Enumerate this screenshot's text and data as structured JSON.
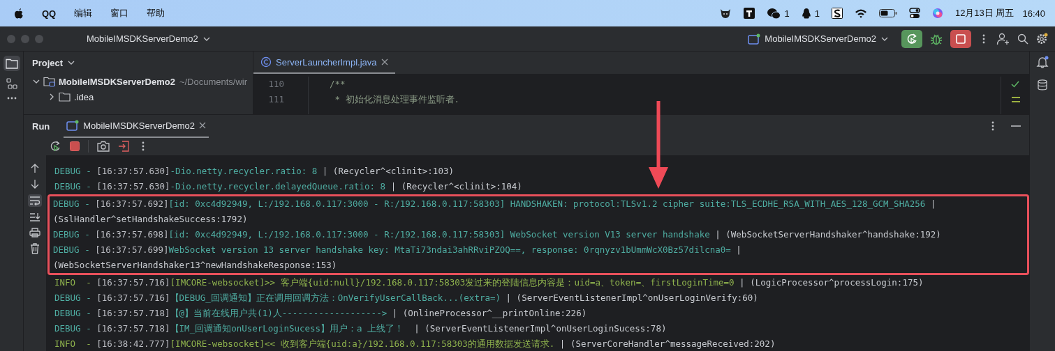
{
  "menubar": {
    "menus": [
      "QQ",
      "编辑",
      "窗口",
      "帮助"
    ],
    "wechat_count": "1",
    "qq_count": "1",
    "date": "12月13日 周五",
    "time": "16:40"
  },
  "titlebar": {
    "project": "MobileIMSDKServerDemo2",
    "run_config": "MobileIMSDKServerDemo2"
  },
  "project_panel": {
    "title": "Project",
    "tree": [
      {
        "name": "MobileIMSDKServerDemo2",
        "path": "~/Documents/wir",
        "expanded": true,
        "children": [
          {
            "name": ".idea",
            "expanded": false
          }
        ]
      }
    ]
  },
  "editor": {
    "tab": "ServerLauncherImpl.java",
    "lines": [
      {
        "number": "110",
        "code": "/**"
      },
      {
        "number": "111",
        "code": " * 初始化消息处理事件监听者."
      }
    ]
  },
  "run_panel": {
    "title": "Run",
    "tab": "MobileIMSDKServerDemo2",
    "log": [
      {
        "level": "DEBUG -",
        "time": "[16:37:57.630]",
        "message": "-Dio.netty.recycler.ratio: 8",
        "source": " | (Recycler^<clinit>:103)",
        "highlighted": false
      },
      {
        "level": "DEBUG -",
        "time": "[16:37:57.630]",
        "message": "-Dio.netty.recycler.delayedQueue.ratio: 8",
        "source": " | (Recycler^<clinit>:104)",
        "highlighted": false
      },
      {
        "level": "DEBUG -",
        "time": "[16:37:57.692]",
        "message": "[id: 0xc4d92949, L:/192.168.0.117:3000 - R:/192.168.0.117:58303] HANDSHAKEN: protocol:TLSv1.2 cipher suite:TLS_ECDHE_RSA_WITH_AES_128_GCM_SHA256",
        "source": " | (SslHandler^setHandshakeSuccess:1792)",
        "highlighted": true
      },
      {
        "level": "DEBUG -",
        "time": "[16:37:57.698]",
        "message": "[id: 0xc4d92949, L:/192.168.0.117:3000 - R:/192.168.0.117:58303] WebSocket version V13 server handshake",
        "source": " | (WebSocketServerHandshaker^handshake:192)",
        "highlighted": true
      },
      {
        "level": "DEBUG -",
        "time": "[16:37:57.699]",
        "message": "WebSocket version 13 server handshake key: MtaTi73ndai3ahRRviPZOQ==, response: 0rqnyzv1bUmmWcX0Bz57dilcna0=",
        "source": " | (WebSocketServerHandshaker13^newHandshakeResponse:153)",
        "highlighted": true
      },
      {
        "level": "INFO  -",
        "time": "[16:37:57.716]",
        "message": "[IMCORE-websocket]>> 客户端{uid:null}/192.168.0.117:58303发过来的登陆信息内容是：uid=a、token=、firstLoginTime=0",
        "source": " | (LogicProcessor^processLogin:175)",
        "highlighted": false
      },
      {
        "level": "DEBUG -",
        "time": "[16:37:57.716]",
        "message": "【DEBUG_回调通知】正在调用回调方法：OnVerifyUserCallBack...(extra=)",
        "source": " | (ServerEventListenerImpl^onUserLoginVerify:60)",
        "highlighted": false
      },
      {
        "level": "DEBUG -",
        "time": "[16:37:57.718]",
        "message": "【@】当前在线用户共(1)人------------------->",
        "source": " | (OnlineProcessor^__printOnline:226)",
        "highlighted": false
      },
      {
        "level": "DEBUG -",
        "time": "[16:37:57.718]",
        "message": "【IM_回调通知onUserLoginSucess】用户：a 上线了！ ",
        "source": " | (ServerEventListenerImpl^onUserLoginSucess:78)",
        "highlighted": false
      },
      {
        "level": "INFO  -",
        "time": "[16:38:42.777]",
        "message": "[IMCORE-websocket]<< 收到客户端{uid:a}/192.168.0.117:58303的通用数据发送请求.",
        "source": " | (ServerCoreHandler^messageReceived:202)",
        "highlighted": false
      }
    ]
  }
}
